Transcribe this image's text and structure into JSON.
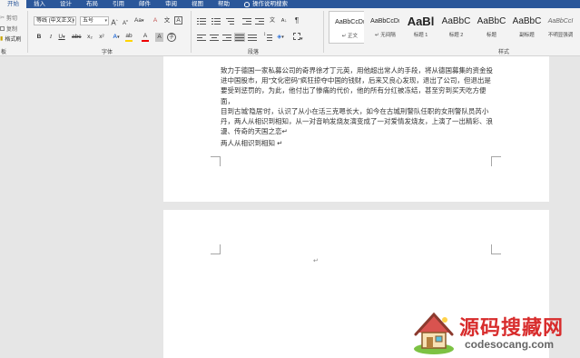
{
  "tabs": [
    "开始",
    "插入",
    "设计",
    "布局",
    "引用",
    "邮件",
    "审阅",
    "视图",
    "帮助",
    "操作说明搜索"
  ],
  "clipboard": {
    "cut": "剪切",
    "copy": "复制",
    "format_painter": "格式刷",
    "group_label": "板"
  },
  "font": {
    "name": "等线 (中文正文)",
    "size": "五号",
    "grow": "A",
    "shrink": "A",
    "case": "Aa",
    "clear": "A",
    "phonetic": "文",
    "border": "A",
    "bold": "B",
    "italic": "I",
    "underline": "U",
    "strike": "abc",
    "subscript": "x₂",
    "superscript": "x²",
    "effects": "A",
    "highlight": "ab",
    "color": "A",
    "shade": "A",
    "circle": "字",
    "group_label": "字体"
  },
  "paragraph": {
    "sort_sym": "A↓",
    "marks_sym": "¶",
    "chinese_sym": "文",
    "group_label": "段落"
  },
  "styles": {
    "items": [
      {
        "preview": "AaBbCcDı",
        "name": "↵ 正文"
      },
      {
        "preview": "AaBbCcDı",
        "name": "↵ 无间隔"
      },
      {
        "preview": "AaBl",
        "name": "标题 1"
      },
      {
        "preview": "AaBbC",
        "name": "标题 2"
      },
      {
        "preview": "AaBbC",
        "name": "标题"
      },
      {
        "preview": "AaBbC",
        "name": "副标题"
      },
      {
        "preview": "AaBbCcI",
        "name": "不明显强调"
      }
    ],
    "group_label": "样式"
  },
  "document": {
    "lines": [
      "致力于德国一家私募公司的奇界徐才丁元英，用他超出常人的手段，将从德国募集的资金投",
      "进中国股市，用\"文化密码\"疯狂掠夺中国的钱财，后来又良心发现，退出了公司，但退出是",
      "要受到惩罚的，为此，他付出了惨痛的代价，他的所有分红被冻结，甚至穷到买天吃方便面，",
      "目到古城'隐居'时，认识了从小在活三克嗯长大，如今在古城刑警队任职的女刑警队员芮小",
      "丹，两人从相识到相知，从一对音响发烧友演变成了一对爱情发烧友，上演了一出精彩、浪",
      "漫、传奇的天国之恋↵"
    ],
    "closing_line": "两人从相识到相知 ↵",
    "para_mark": "↵"
  },
  "watermark": {
    "title": "源码搜藏网",
    "url": "codesocang.com"
  }
}
